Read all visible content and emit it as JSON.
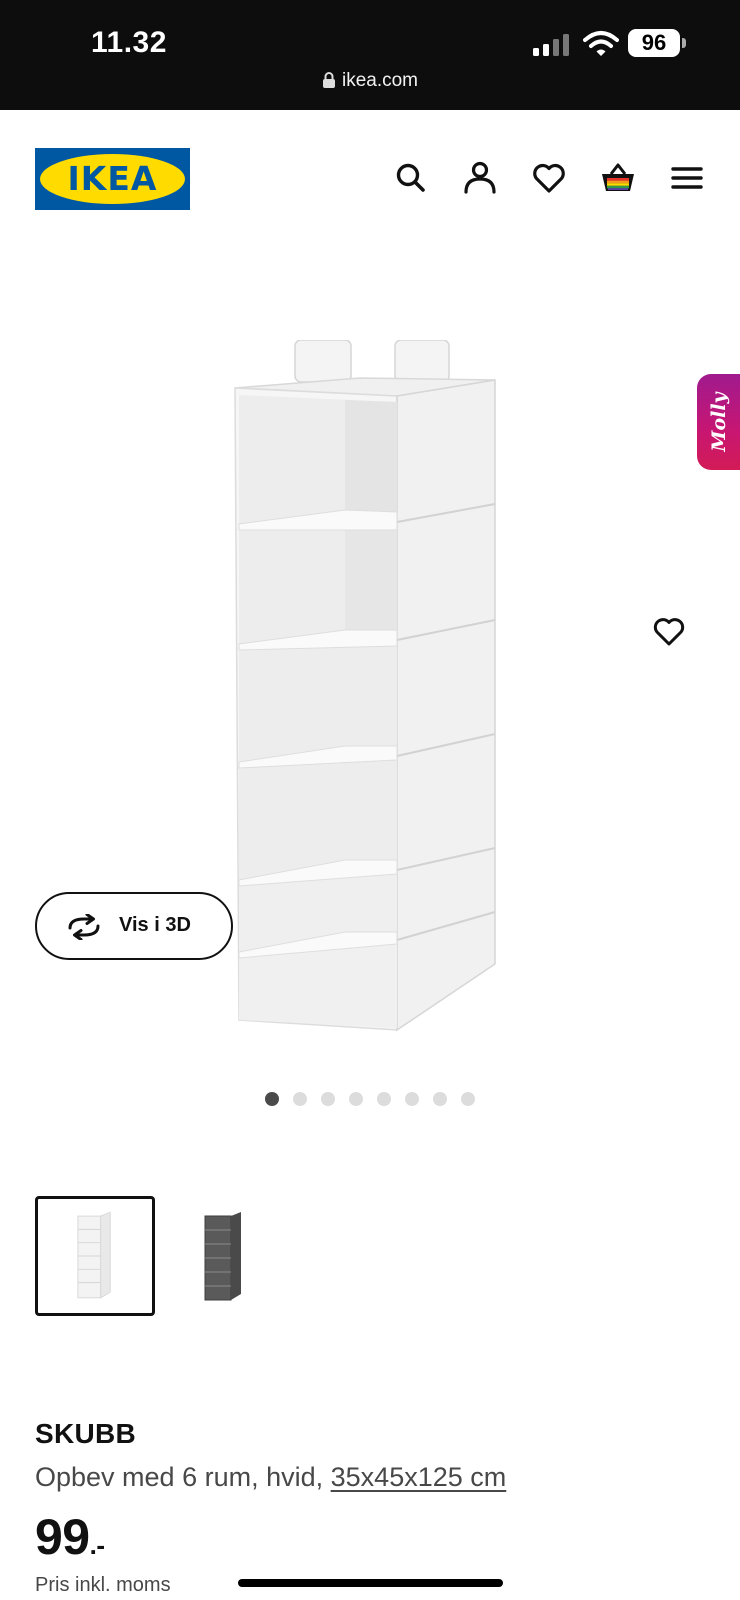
{
  "status_bar": {
    "time": "11.32",
    "battery": "96",
    "url": "ikea.com"
  },
  "header": {
    "logo_text": "IKEA",
    "icons": [
      "search-icon",
      "account-icon",
      "heart-icon",
      "basket-icon",
      "menu-icon"
    ]
  },
  "gallery": {
    "view_3d_label": "Vis i 3D",
    "assistant_label": "Molly",
    "dots_total": 8,
    "dots_active": 0,
    "thumbnails": [
      "white",
      "dark-grey"
    ]
  },
  "product": {
    "name": "SKUBB",
    "description": "Opbev med 6 rum, hvid, ",
    "dimensions": "35x45x125 cm",
    "price": "99",
    "price_suffix": ".-",
    "vat_note": "Pris inkl. moms"
  },
  "colors": {
    "ikea_blue": "#0058a3",
    "ikea_yellow": "#ffdb00",
    "assistant_gradient_start": "#a01a8e",
    "assistant_gradient_end": "#d21b56"
  }
}
